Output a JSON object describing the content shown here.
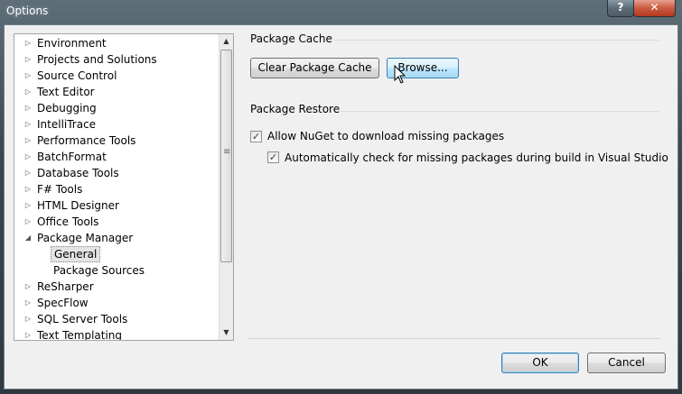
{
  "window": {
    "title": "Options",
    "help_glyph": "?",
    "close_glyph": "✕"
  },
  "tree": {
    "items": [
      {
        "label": "Environment",
        "expanded": false,
        "level": 0
      },
      {
        "label": "Projects and Solutions",
        "expanded": false,
        "level": 0
      },
      {
        "label": "Source Control",
        "expanded": false,
        "level": 0
      },
      {
        "label": "Text Editor",
        "expanded": false,
        "level": 0
      },
      {
        "label": "Debugging",
        "expanded": false,
        "level": 0
      },
      {
        "label": "IntelliTrace",
        "expanded": false,
        "level": 0
      },
      {
        "label": "Performance Tools",
        "expanded": false,
        "level": 0
      },
      {
        "label": "BatchFormat",
        "expanded": false,
        "level": 0
      },
      {
        "label": "Database Tools",
        "expanded": false,
        "level": 0
      },
      {
        "label": "F# Tools",
        "expanded": false,
        "level": 0
      },
      {
        "label": "HTML Designer",
        "expanded": false,
        "level": 0
      },
      {
        "label": "Office Tools",
        "expanded": false,
        "level": 0
      },
      {
        "label": "Package Manager",
        "expanded": true,
        "level": 0
      },
      {
        "label": "General",
        "level": 1,
        "selected": true
      },
      {
        "label": "Package Sources",
        "level": 1
      },
      {
        "label": "ReSharper",
        "expanded": false,
        "level": 0
      },
      {
        "label": "SpecFlow",
        "expanded": false,
        "level": 0
      },
      {
        "label": "SQL Server Tools",
        "expanded": false,
        "level": 0
      },
      {
        "label": "Text Templating",
        "expanded": false,
        "level": 0
      }
    ]
  },
  "package_cache": {
    "header": "Package Cache",
    "clear_button": "Clear Package Cache",
    "browse_button": "Browse..."
  },
  "package_restore": {
    "header": "Package Restore",
    "allow_download": {
      "label": "Allow NuGet to download missing packages",
      "checked": true
    },
    "auto_check": {
      "label": "Automatically check for missing packages during build in Visual Studio",
      "checked": true
    }
  },
  "footer": {
    "ok_button": "OK",
    "cancel_button": "Cancel"
  }
}
